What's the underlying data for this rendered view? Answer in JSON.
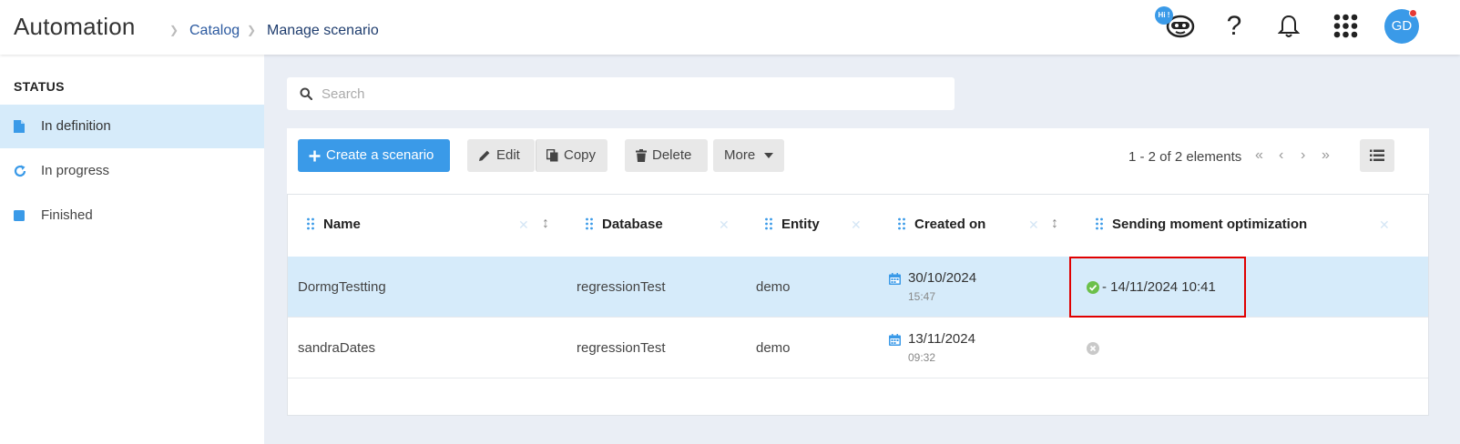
{
  "header": {
    "app_title": "Automation",
    "breadcrumb": [
      "Catalog",
      "Manage scenario"
    ],
    "hi_badge": "Hi !",
    "help_symbol": "?",
    "avatar_initials": "GD"
  },
  "sidebar": {
    "heading": "STATUS",
    "items": [
      {
        "label": "In definition",
        "icon": "file-icon"
      },
      {
        "label": "In progress",
        "icon": "refresh-icon"
      },
      {
        "label": "Finished",
        "icon": "square-icon"
      }
    ]
  },
  "search": {
    "placeholder": "Search",
    "value": ""
  },
  "toolbar": {
    "create_label": "Create a scenario",
    "edit_label": "Edit",
    "copy_label": "Copy",
    "delete_label": "Delete",
    "more_label": "More",
    "pager_text": "1 - 2 of 2 elements"
  },
  "table": {
    "columns": [
      "Name",
      "Database",
      "Entity",
      "Created on",
      "Sending moment optimization"
    ],
    "rows": [
      {
        "name": "DormgTestting",
        "database": "regressionTest",
        "entity": "demo",
        "created_date": "30/10/2024",
        "created_time": "15:47",
        "optimization": "- 14/11/2024 10:41",
        "optimization_status": "ok",
        "selected": true
      },
      {
        "name": "sandraDates",
        "database": "regressionTest",
        "entity": "demo",
        "created_date": "13/11/2024",
        "created_time": "09:32",
        "optimization": "",
        "optimization_status": "none",
        "selected": false
      }
    ]
  },
  "colors": {
    "accent": "#3a9ae8",
    "selected_row": "#d6ebfa",
    "highlight_border": "#e00000",
    "ok_green": "#6cc04a"
  }
}
